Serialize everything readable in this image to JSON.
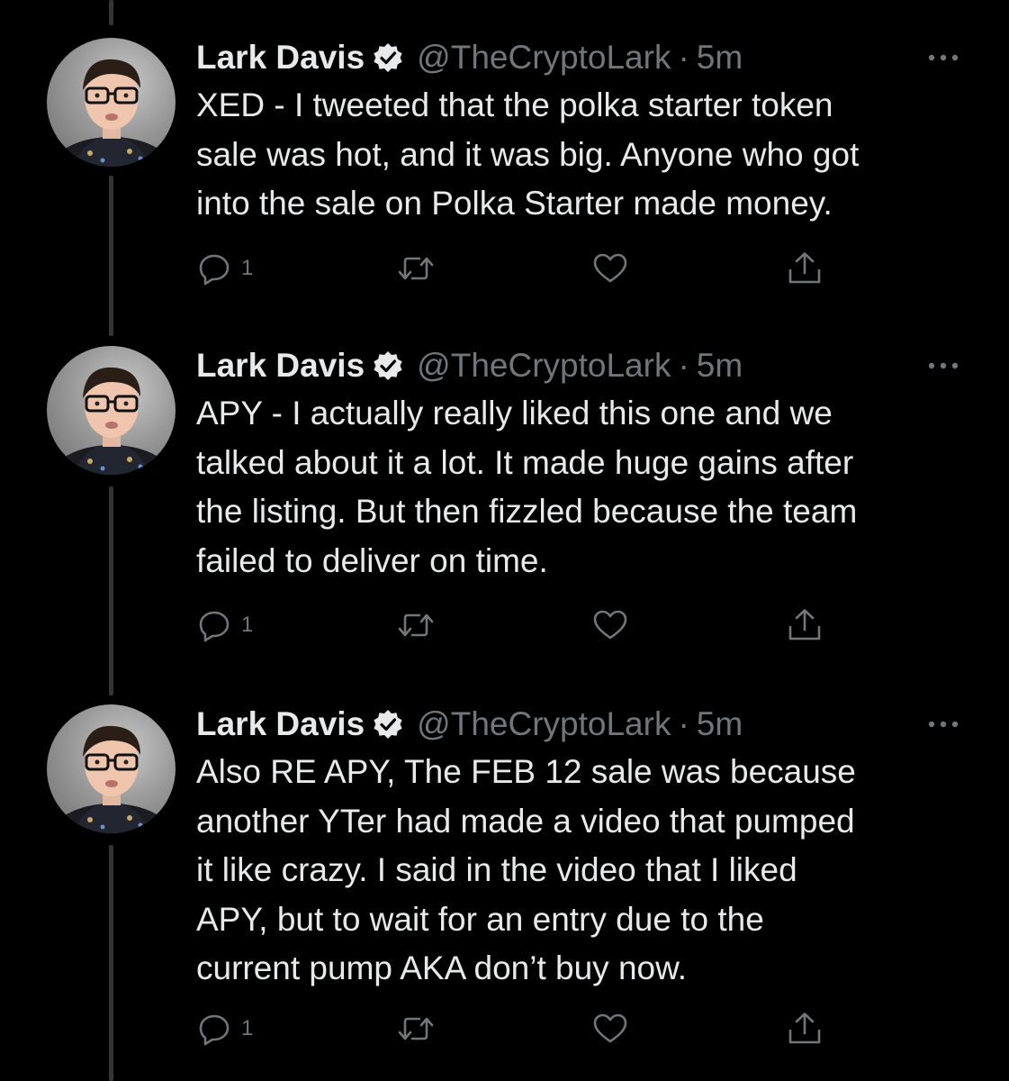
{
  "thread": {
    "tweets": [
      {
        "author_name": "Lark Davis",
        "handle": "@TheCryptoLark",
        "separator": "·",
        "time": "5m",
        "text": "XED - I tweeted that the polka starter token\nsale was hot, and it was big. Anyone who got\ninto the sale on Polka Starter made money.",
        "reply_count": "1"
      },
      {
        "author_name": "Lark Davis",
        "handle": "@TheCryptoLark",
        "separator": "·",
        "time": "5m",
        "text": "APY - I actually really liked this one and we\ntalked about it a lot. It made huge gains after\nthe listing. But then fizzled because the team\nfailed to deliver on time.",
        "reply_count": "1"
      },
      {
        "author_name": "Lark Davis",
        "handle": "@TheCryptoLark",
        "separator": "·",
        "time": "5m",
        "text": "Also RE APY, The FEB 12 sale was because\nanother YTer had made a video that pumped\nit like crazy. I said in the video that I liked\nAPY, but to wait for an entry due to the\ncurrent pump AKA don’t buy now.",
        "reply_count": "1"
      }
    ]
  },
  "icons": {
    "verified": "verified-badge-icon",
    "more": "more-options-icon",
    "reply": "reply-icon",
    "retweet": "retweet-icon",
    "like": "like-icon",
    "share": "share-icon"
  },
  "colors": {
    "background": "#000000",
    "text_primary": "#e7e9ea",
    "text_secondary": "#71767b",
    "thread_line": "#333639"
  }
}
